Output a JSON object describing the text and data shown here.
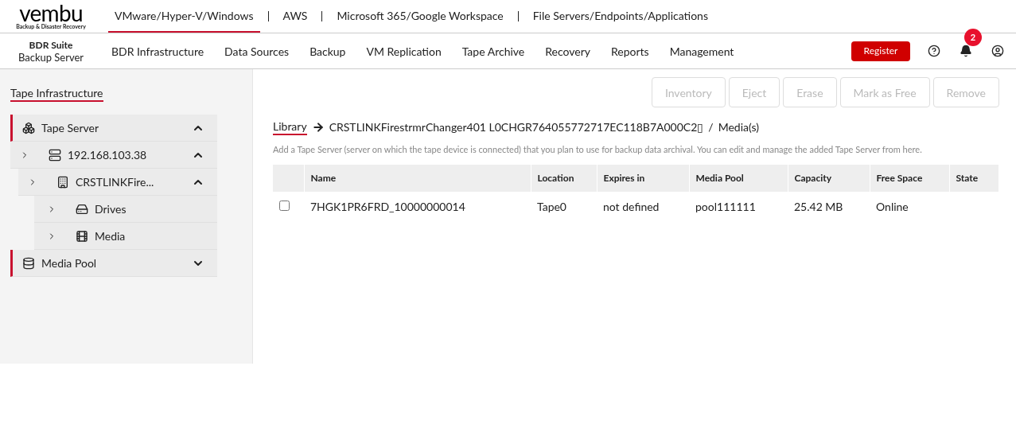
{
  "brand": {
    "name": "vembu",
    "tagline": "Backup & Disaster Recovery"
  },
  "product_tabs": [
    {
      "label": "VMware/Hyper-V/Windows",
      "selected": true
    },
    {
      "label": "AWS",
      "selected": false
    },
    {
      "label": "Microsoft 365/Google Workspace",
      "selected": false
    },
    {
      "label": "File Servers/Endpoints/Applications",
      "selected": false
    }
  ],
  "suite": {
    "title": "BDR Suite",
    "subtitle": "Backup Server"
  },
  "main_nav": [
    "BDR Infrastructure",
    "Data Sources",
    "Backup",
    "VM Replication",
    "Tape Archive",
    "Recovery",
    "Reports",
    "Management"
  ],
  "register_button": "Register",
  "notifications_badge": "2",
  "sidebar": {
    "title": "Tape Infrastructure",
    "tree": [
      {
        "label": "Tape Server",
        "kind": "cubes",
        "expanded": true,
        "children": [
          {
            "label": "192.168.103.38",
            "kind": "server",
            "expanded": true,
            "children": [
              {
                "label": "CRSTLINKFire...",
                "kind": "building",
                "expanded": true,
                "children": [
                  {
                    "label": "Drives",
                    "kind": "drive"
                  },
                  {
                    "label": "Media",
                    "kind": "film"
                  }
                ]
              }
            ]
          }
        ]
      },
      {
        "label": "Media Pool",
        "kind": "database",
        "expanded": false
      }
    ]
  },
  "toolbar": [
    {
      "label": "Inventory",
      "disabled": true
    },
    {
      "label": "Eject",
      "disabled": true
    },
    {
      "label": "Erase",
      "disabled": true
    },
    {
      "label": "Mark as Free",
      "disabled": true
    },
    {
      "label": "Remove",
      "disabled": true
    }
  ],
  "breadcrumb": {
    "root": "Library",
    "device": "CRSTLINKFirestrmrChanger401 L0CHGR764055772717EC118B7A000C2▯",
    "separator": "/",
    "current": "Media(s)"
  },
  "description": "Add a Tape Server (server on which the tape device is connected) that you plan to use for backup data archival. You can edit and manage the added Tape Server from here.",
  "table": {
    "columns": [
      "Name",
      "Location",
      "Expires in",
      "Media Pool",
      "Capacity",
      "Free Space",
      "State"
    ],
    "rows": [
      {
        "checked": false,
        "cells": [
          "7HGK1PR6FRD_10000000014",
          "Tape0",
          "not defined",
          "pool111111",
          "25.42 MB",
          "Online",
          ""
        ]
      }
    ]
  }
}
